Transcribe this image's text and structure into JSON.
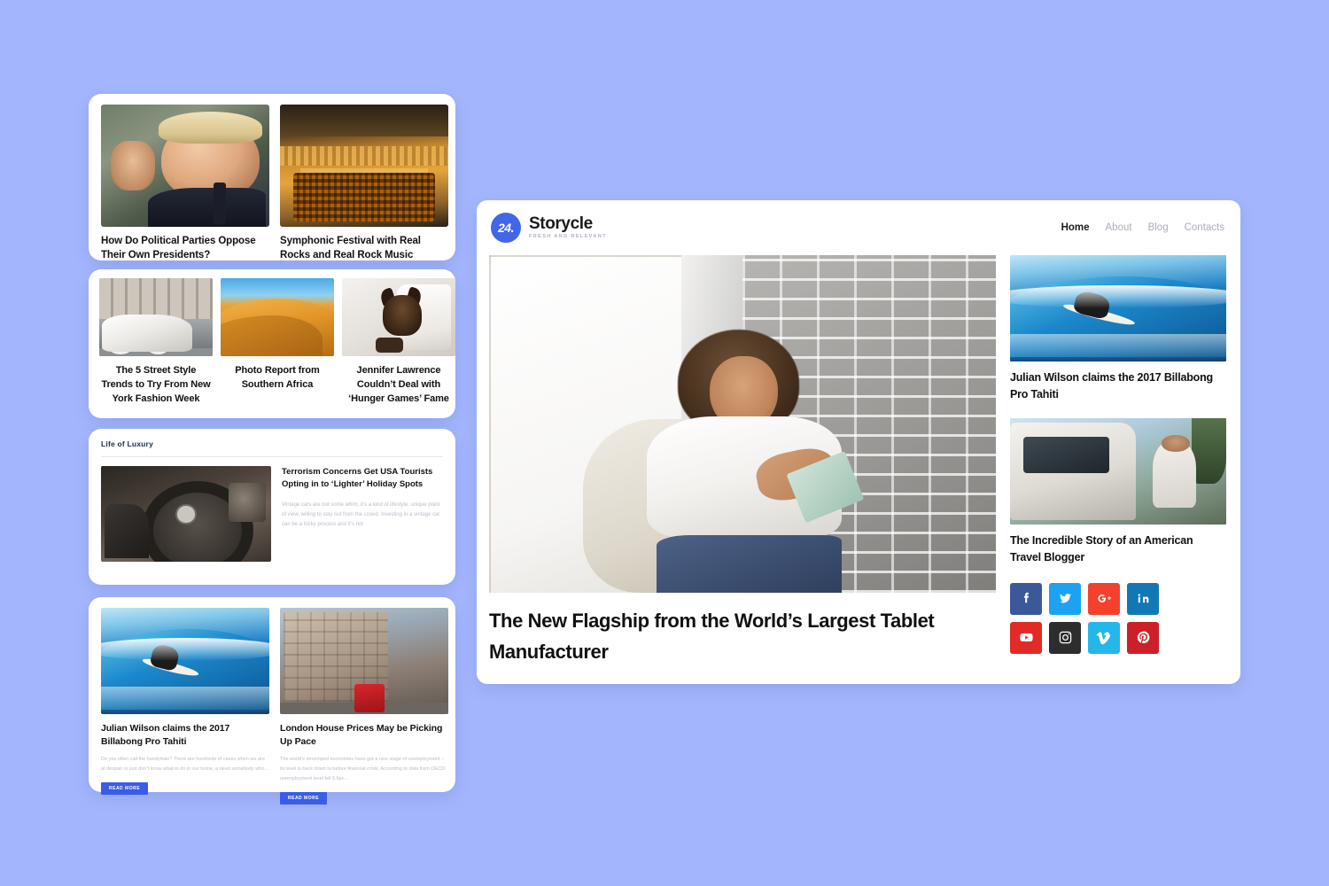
{
  "background_color": "#a3b6fd",
  "left_cards": {
    "two_up": {
      "items": [
        {
          "title": "How Do Political Parties Oppose Their Own Presidents?",
          "image": "trump-portrait-photo"
        },
        {
          "title": "Symphonic Festival with Real Rocks and Real Rock Music",
          "image": "concert-hall-photo"
        }
      ]
    },
    "three_up": {
      "items": [
        {
          "title": "The 5 Street Style Trends to Try From New York Fashion Week",
          "image": "vintage-car-street-photo"
        },
        {
          "title": "Photo Report from Southern Africa",
          "image": "desert-dunes-photo"
        },
        {
          "title": "Jennifer Lawrence Couldn’t Deal with ‘Hunger Games’ Fame",
          "image": "dog-in-robe-photo"
        }
      ]
    },
    "luxury": {
      "kicker": "Life of Luxury",
      "item": {
        "title": "Terrorism Concerns Get USA Tourists Opting in to ‘Lighter’ Holiday Spots",
        "excerpt": "Vintage cars are not some whim, it’s a kind of lifestyle, unique point of view, willing to stay out from the crowd. Investing in a vintage car can be a tricky process and it’s not",
        "image": "mercedes-steering-wheel-photo"
      }
    },
    "read_more": {
      "button_label": "READ MORE",
      "items": [
        {
          "title": "Julian Wilson claims the 2017 Billabong Pro Tahiti",
          "excerpt": "Do you often call the handyman? There are hundreds of cases when we are at despair or just don’t know what to do in our home, a need somebody who...",
          "image": "surfer-wave-photo"
        },
        {
          "title": "London House Prices May be Picking Up Pace",
          "excerpt": "The world’s developed economies have got a new stage of unemployment – its level is back down to before financial crisis. According to data from OECD unemployment level fell 5.6pc...",
          "image": "london-street-photo"
        }
      ]
    }
  },
  "main_panel": {
    "brand": {
      "mark": "24.",
      "name": "Storycle",
      "tagline": "FRESH AND RELEVANT",
      "mark_color": "#4266e8"
    },
    "nav": [
      {
        "label": "Home",
        "active": true
      },
      {
        "label": "About",
        "active": false
      },
      {
        "label": "Blog",
        "active": false
      },
      {
        "label": "Contacts",
        "active": false
      }
    ],
    "hero": {
      "title": "The New Flagship from the World’s Largest Tablet Manufacturer",
      "image": "woman-with-tablet-photo"
    },
    "sidebar_items": [
      {
        "title": "Julian Wilson claims the 2017 Billabong Pro Tahiti",
        "image": "surfer-wave-photo"
      },
      {
        "title": "The Incredible Story of an American Travel Blogger",
        "image": "travel-blogger-van-photo"
      }
    ],
    "social": [
      {
        "name": "facebook",
        "glyph": "f",
        "color": "#3b5998"
      },
      {
        "name": "twitter",
        "glyph": "t",
        "color": "#1da1f2"
      },
      {
        "name": "google-plus",
        "glyph": "g+",
        "color": "#f4412c"
      },
      {
        "name": "linkedin",
        "glyph": "in",
        "color": "#1278b5"
      },
      {
        "name": "youtube",
        "glyph": "yt",
        "color": "#e22b26"
      },
      {
        "name": "instagram",
        "glyph": "ig",
        "color": "#2d2d2d"
      },
      {
        "name": "vimeo",
        "glyph": "v",
        "color": "#24b7ea"
      },
      {
        "name": "pinterest",
        "glyph": "p",
        "color": "#cb2027"
      }
    ]
  }
}
